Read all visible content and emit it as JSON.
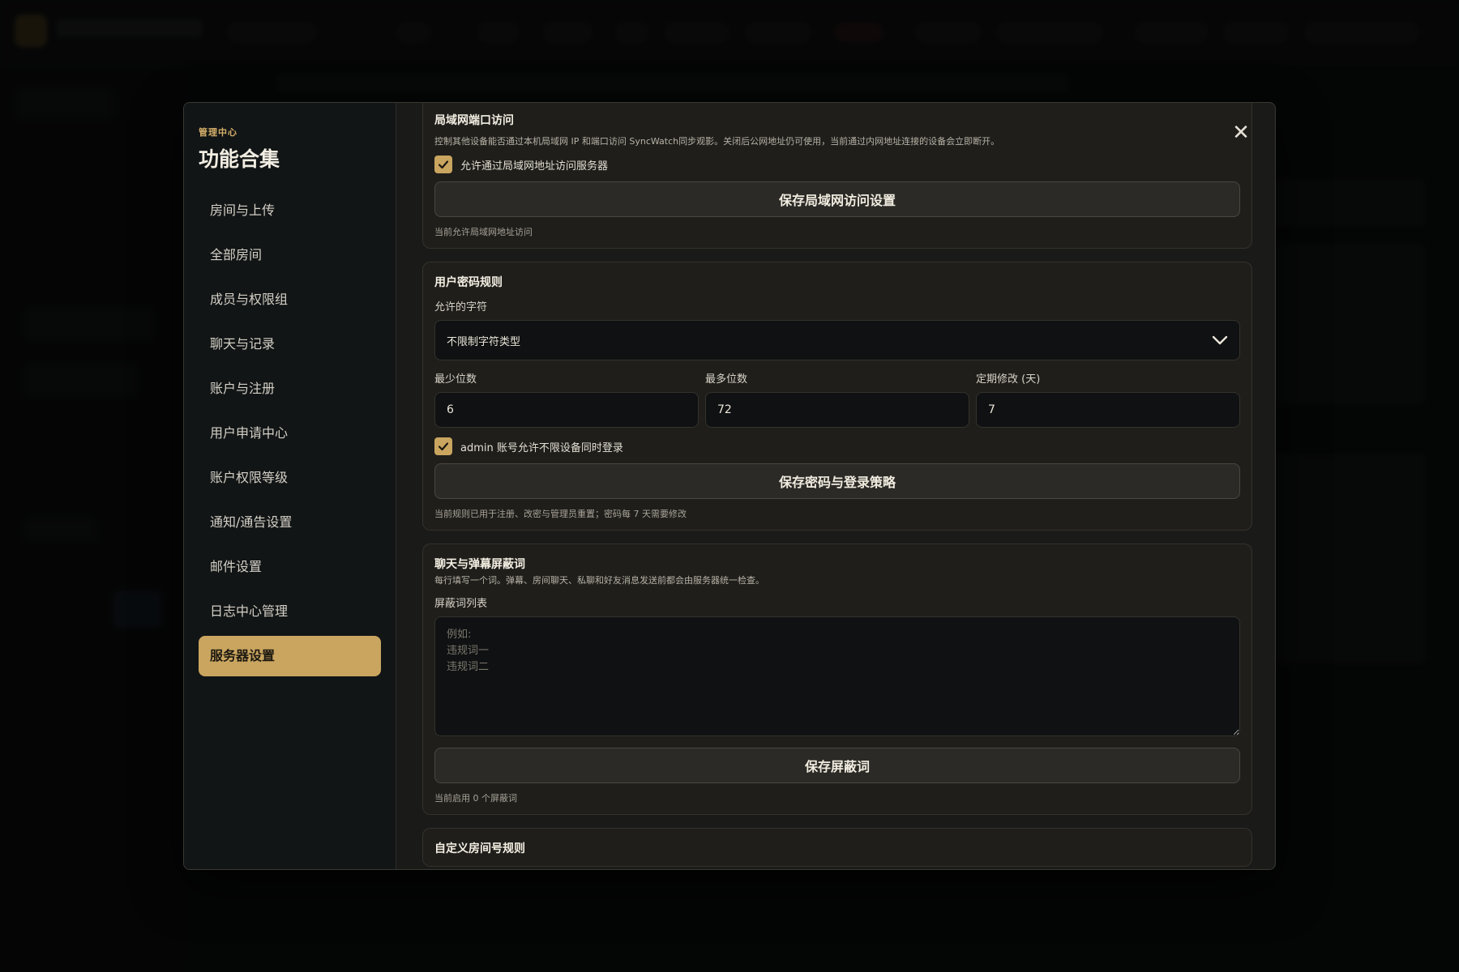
{
  "nav": {
    "kicker": "管理中心",
    "title": "功能合集",
    "items": [
      {
        "label": "房间与上传",
        "active": false
      },
      {
        "label": "全部房间",
        "active": false
      },
      {
        "label": "成员与权限组",
        "active": false
      },
      {
        "label": "聊天与记录",
        "active": false
      },
      {
        "label": "账户与注册",
        "active": false
      },
      {
        "label": "用户申请中心",
        "active": false
      },
      {
        "label": "账户权限等级",
        "active": false
      },
      {
        "label": "通知/通告设置",
        "active": false
      },
      {
        "label": "邮件设置",
        "active": false
      },
      {
        "label": "日志中心管理",
        "active": false
      },
      {
        "label": "服务器设置",
        "active": true
      }
    ]
  },
  "close_symbol": "✕",
  "lan": {
    "title": "局域网端口访问",
    "description": "控制其他设备能否通过本机局域网 IP 和端口访问 SyncWatch同步观影。关闭后公网地址仍可使用，当前通过内网地址连接的设备会立即断开。",
    "checkbox_label": "允许通过局域网地址访问服务器",
    "checked": true,
    "save_label": "保存局域网访问设置",
    "status": "当前允许局域网地址访问"
  },
  "password": {
    "title": "用户密码规则",
    "charset_label": "允许的字符",
    "charset_value": "不限制字符类型",
    "min_label": "最少位数",
    "min_value": "6",
    "max_label": "最多位数",
    "max_value": "72",
    "expire_label": "定期修改 (天)",
    "expire_value": "7",
    "checkbox_label": "admin 账号允许不限设备同时登录",
    "checked": true,
    "save_label": "保存密码与登录策略",
    "status": "当前规则已用于注册、改密与管理员重置；密码每 7 天需要修改"
  },
  "blocklist": {
    "title": "聊天与弹幕屏蔽词",
    "description": "每行填写一个词。弹幕、房间聊天、私聊和好友消息发送前都会由服务器统一检查。",
    "list_label": "屏蔽词列表",
    "placeholder": "例如:\n违规词一\n违规词二",
    "save_label": "保存屏蔽词",
    "status": "当前启用 0 个屏蔽词"
  },
  "room_rules": {
    "title": "自定义房间号规则"
  },
  "colors": {
    "accent": "#c9a55f",
    "panel": "#1f1e1b",
    "sidebar": "#121516"
  }
}
